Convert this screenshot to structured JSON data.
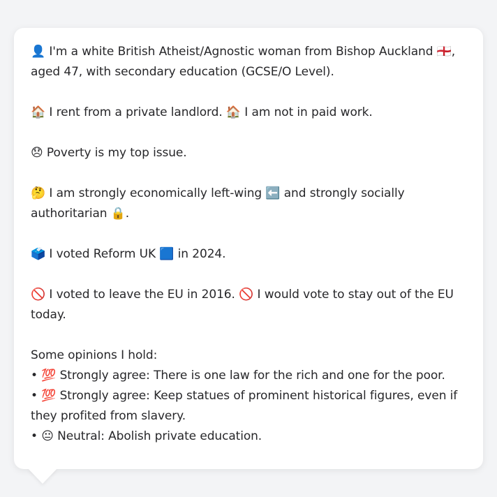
{
  "persona": {
    "intro": "👤 I'm a white British Atheist/Agnostic woman from Bishop Auckland 🏴󠁧󠁢󠁥󠁮󠁧󠁿, aged 47, with secondary education (GCSE/O Level).",
    "housing_work": "🏠 I rent from a private landlord. 🏠 I am not in paid work.",
    "top_issue": "😞 Poverty is my top issue.",
    "ideology": "🤔 I am strongly economically left-wing ⬅️ and strongly socially authoritarian 🔒.",
    "vote_2024": "🗳️ I voted Reform UK 🟦 in 2024.",
    "eu": "🚫 I voted to leave the EU in 2016. 🚫 I would vote to stay out of the EU today.",
    "opinions_heading": "Some opinions I hold:",
    "opinions": [
      "• 💯 Strongly agree: There is one law for the rich and one for the poor.",
      "• 💯 Strongly agree: Keep statues of prominent historical figures, even if they profited from slavery.",
      "• 😐 Neutral: Abolish private education."
    ]
  }
}
